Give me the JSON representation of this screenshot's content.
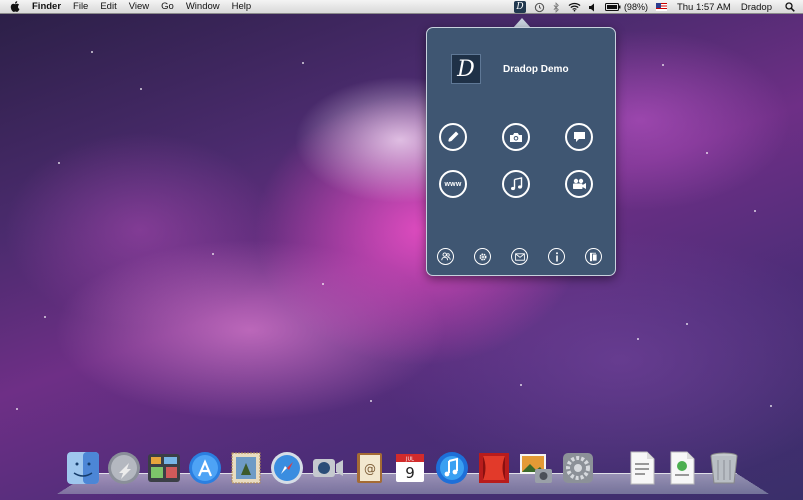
{
  "menubar": {
    "apple_icon": "apple-icon",
    "app_name": "Finder",
    "menus": [
      "File",
      "Edit",
      "View",
      "Go",
      "Window",
      "Help"
    ],
    "status": {
      "battery_percent": "(98%)",
      "clock": "Thu 1:57 AM",
      "user": "Dradop"
    }
  },
  "popover": {
    "app_name": "Dradop Demo",
    "logo_letter": "D",
    "www_label": "www",
    "actions": [
      {
        "icon": "pencil-icon"
      },
      {
        "icon": "camera-icon"
      },
      {
        "icon": "speech-bubble-icon"
      },
      {
        "icon": "www-icon"
      },
      {
        "icon": "music-note-icon"
      },
      {
        "icon": "video-camera-icon"
      }
    ],
    "footer_actions": [
      {
        "icon": "users-icon"
      },
      {
        "icon": "gear-icon"
      },
      {
        "icon": "envelope-icon"
      },
      {
        "icon": "info-icon"
      },
      {
        "icon": "exit-icon"
      }
    ]
  },
  "dock": {
    "calendar_month": "JUL",
    "calendar_day": "9",
    "items": [
      "finder",
      "launchpad",
      "mission-control",
      "app-store",
      "mail",
      "safari",
      "facetime",
      "address-book",
      "ical",
      "itunes",
      "photo-booth",
      "iphoto",
      "system-preferences",
      "document",
      "document",
      "trash"
    ]
  },
  "colors": {
    "popover_bg": "#3f5672",
    "popover_border": "#c8d2de",
    "menubar_bg": "#e6e6e6"
  }
}
